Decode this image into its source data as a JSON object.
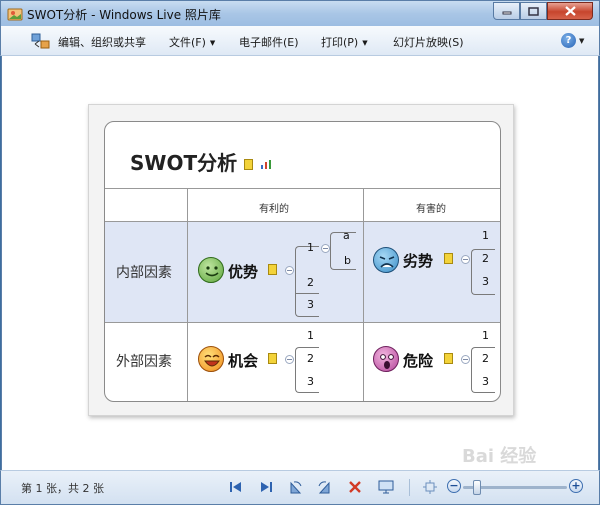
{
  "window": {
    "title": "SWOT分析 - Windows Live 照片库"
  },
  "menu": {
    "share_label": "编辑、组织或共享",
    "file_label": "文件(F)",
    "email_label": "电子邮件(E)",
    "print_label": "打印(P)",
    "slideshow_label": "幻灯片放映(S)",
    "help_label": "?"
  },
  "diagram": {
    "title": "SWOT分析",
    "col_favorable": "有利的",
    "col_unfavorable": "有害的",
    "row_internal": "内部因素",
    "row_external": "外部因素",
    "strengths": {
      "label": "优势",
      "items": [
        "1",
        "2",
        "3"
      ],
      "sub_items": [
        "a",
        "b"
      ]
    },
    "weaknesses": {
      "label": "劣势",
      "items": [
        "1",
        "2",
        "3"
      ]
    },
    "opportunities": {
      "label": "机会",
      "items": [
        "1",
        "2",
        "3"
      ]
    },
    "threats": {
      "label": "危险",
      "items": [
        "1",
        "2",
        "3"
      ]
    }
  },
  "statusbar": {
    "page_count": "第 1 张，共 2 张"
  },
  "watermark": {
    "text": "Bai 经验"
  },
  "colors": {
    "internal_row_bg": "#dfe6f5",
    "title_bar": "#a9c6e6",
    "close_button": "#c7452d"
  }
}
